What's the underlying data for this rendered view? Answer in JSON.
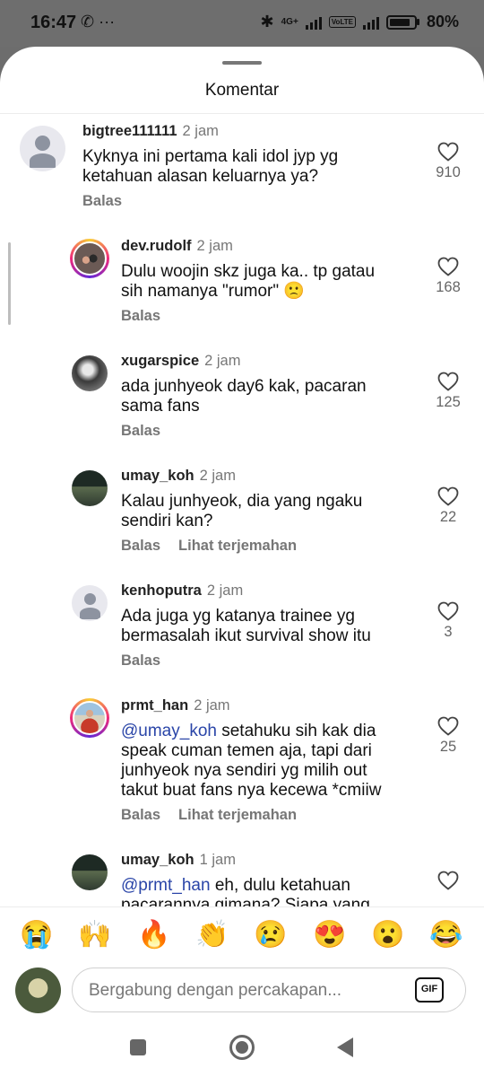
{
  "status_bar": {
    "time": "16:47",
    "left_icons": "✆ ···",
    "bluetooth": "✱",
    "network": "4G+",
    "volte": "VoLTE",
    "battery": "80%"
  },
  "sheet": {
    "title": "Komentar"
  },
  "comments": [
    {
      "username": "bigtree111111",
      "time": "2 jam",
      "mention": "",
      "text": "Kyknya ini pertama kali idol jyp yg\nketahuan alasan keluarnya ya?",
      "reply": "Balas",
      "translate": "",
      "likes": "910"
    },
    {
      "username": "dev.rudolf",
      "time": "2 jam",
      "mention": "",
      "text": "Dulu woojin skz juga ka.. tp gatau\nsih namanya \"rumor\" 🙁",
      "reply": "Balas",
      "translate": "",
      "likes": "168"
    },
    {
      "username": "xugarspice",
      "time": "2 jam",
      "mention": "",
      "text": "ada junhyeok day6 kak, pacaran\nsama fans",
      "reply": "Balas",
      "translate": "",
      "likes": "125"
    },
    {
      "username": "umay_koh",
      "time": "2 jam",
      "mention": "",
      "text": "Kalau junhyeok, dia yang ngaku\nsendiri kan?",
      "reply": "Balas",
      "translate": "Lihat terjemahan",
      "likes": "22"
    },
    {
      "username": "kenhoputra",
      "time": "2 jam",
      "mention": "",
      "text": "Ada juga yg katanya trainee yg\nbermasalah ikut survival show itu",
      "reply": "Balas",
      "translate": "",
      "likes": "3"
    },
    {
      "username": "prmt_han",
      "time": "2 jam",
      "mention": "@umay_koh",
      "text": " setahuku sih kak dia\nspeak cuman temen aja, tapi dari\njunhyeok nya sendiri yg milih out\ntakut buat fans nya kecewa *cmiiw",
      "reply": "Balas",
      "translate": "Lihat terjemahan",
      "likes": "25"
    },
    {
      "username": "umay_koh",
      "time": "1 jam",
      "mention": "@prmt_han",
      "text": " eh, dulu ketahuan\npacarannya gimana? Siapa yang",
      "reply": "",
      "translate": "",
      "likes": ""
    }
  ],
  "emoji_bar": [
    "😭",
    "🙌",
    "🔥",
    "👏",
    "😢",
    "😍",
    "😮",
    "😂"
  ],
  "input": {
    "placeholder": "Bergabung dengan percakapan...",
    "gif_label": "GIF"
  }
}
